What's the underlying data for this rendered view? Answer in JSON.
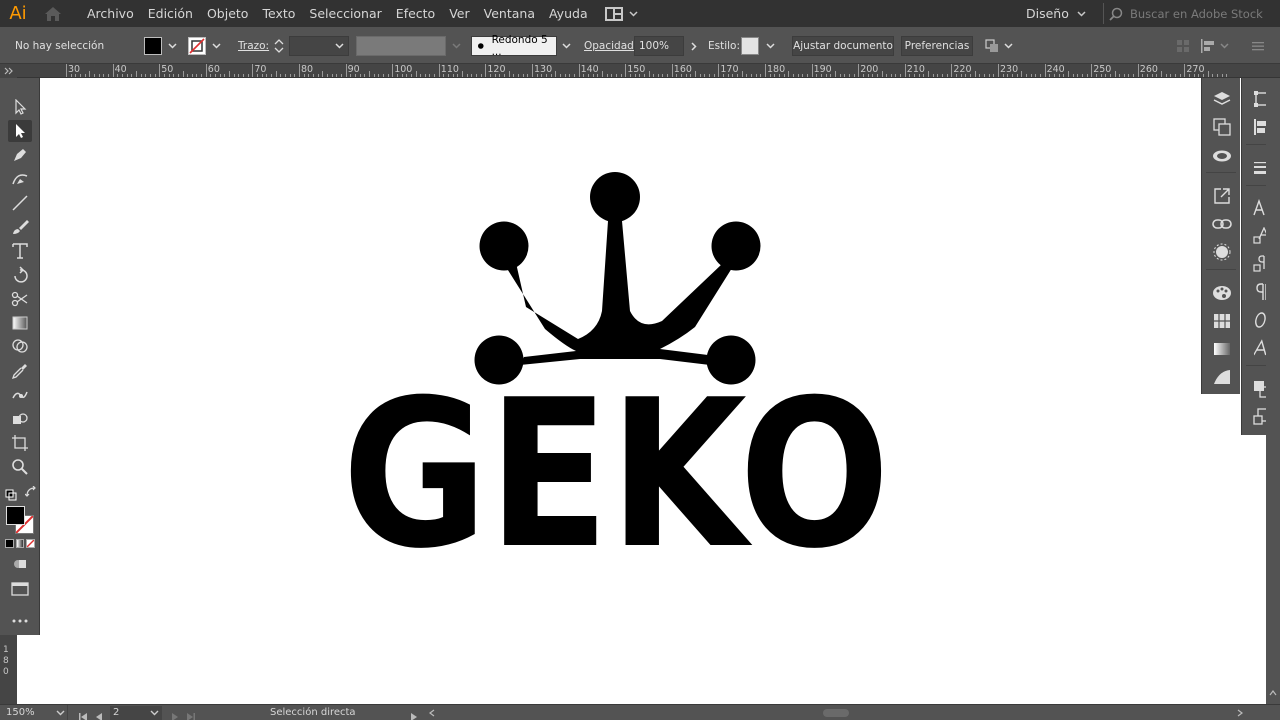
{
  "app": {
    "logo_text": "Ai",
    "logo_color": "#FF9A00"
  },
  "menu": {
    "items": [
      "Archivo",
      "Edición",
      "Objeto",
      "Texto",
      "Seleccionar",
      "Efecto",
      "Ver",
      "Ventana",
      "Ayuda"
    ]
  },
  "workspace": {
    "label": "Diseño"
  },
  "stock_search": {
    "placeholder": "Buscar en Adobe Stock"
  },
  "control": {
    "selection_status": "No hay selección",
    "stroke_label": "Trazo:",
    "brush_label": "Redondo 5 ...",
    "opacity_label": "Opacidad:",
    "opacity_value": "100%",
    "style_label": "Estilo:",
    "adjust_document": "Ajustar documento",
    "preferences": "Preferencias"
  },
  "ruler": {
    "labels": [
      "30",
      "40",
      "50",
      "60",
      "70",
      "80",
      "90",
      "100",
      "110",
      "120",
      "130",
      "140",
      "150",
      "160",
      "170",
      "180",
      "190",
      "200",
      "210",
      "220",
      "230",
      "240",
      "250",
      "260",
      "270"
    ],
    "vertical_labels": [
      "1",
      "8",
      "0"
    ]
  },
  "artwork": {
    "text": "GEKO",
    "color": "#000000"
  },
  "status": {
    "zoom": "150%",
    "artboard": "2",
    "tool_name": "Selección directa"
  },
  "tools": [
    "selection-tool",
    "direct-selection-tool",
    "pen-tool",
    "curvature-tool",
    "line-tool",
    "paintbrush-tool",
    "type-tool",
    "rotate-tool",
    "scissors-tool",
    "gradient-tool",
    "shape-builder-tool",
    "eyedropper-tool",
    "puppet-warp-tool",
    "live-paint-tool",
    "artboard-tool",
    "zoom-tool"
  ],
  "dock1_icons": [
    "layers-icon",
    "artboards-icon",
    "libraries-icon",
    "export-icon",
    "links-icon",
    "color-guide-icon",
    "swatches-icon",
    "symbols-icon",
    "gradient-icon",
    "transparency-icon"
  ],
  "dock2_icons": [
    "transform-icon",
    "align-icon",
    "stroke-icon",
    "character-icon",
    "character-styles-icon",
    "paragraph-styles-icon",
    "paragraph-icon",
    "opentype-icon",
    "glyphs-icon",
    "pathfinder-icon",
    "asset-export-icon"
  ]
}
